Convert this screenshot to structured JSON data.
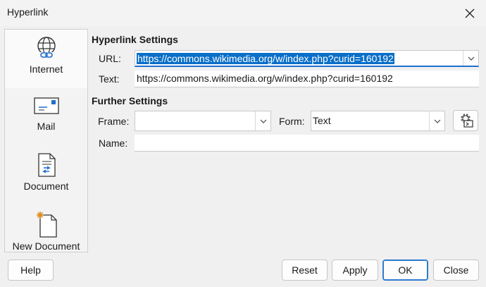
{
  "window": {
    "title": "Hyperlink"
  },
  "sidebar": {
    "items": [
      {
        "label": "Internet",
        "icon": "globe-link-icon",
        "selected": true
      },
      {
        "label": "Mail",
        "icon": "envelope-icon",
        "selected": false
      },
      {
        "label": "Document",
        "icon": "document-icon",
        "selected": false
      },
      {
        "label": "New Document",
        "icon": "new-document-icon",
        "selected": false
      }
    ]
  },
  "hyperlink_settings": {
    "heading": "Hyperlink Settings",
    "url_label": "URL:",
    "url_value": "https://commons.wikimedia.org/w/index.php?curid=160192",
    "text_label": "Text:",
    "text_value": "https://commons.wikimedia.org/w/index.php?curid=160192"
  },
  "further_settings": {
    "heading": "Further Settings",
    "frame_label": "Frame:",
    "frame_value": "",
    "form_label": "Form:",
    "form_value": "Text",
    "name_label": "Name:",
    "name_value": ""
  },
  "buttons": {
    "help": "Help",
    "reset": "Reset",
    "apply": "Apply",
    "ok": "OK",
    "close": "Close"
  },
  "colors": {
    "selection": "#0a6fc8",
    "default_button_border": "#2e7bcf"
  }
}
